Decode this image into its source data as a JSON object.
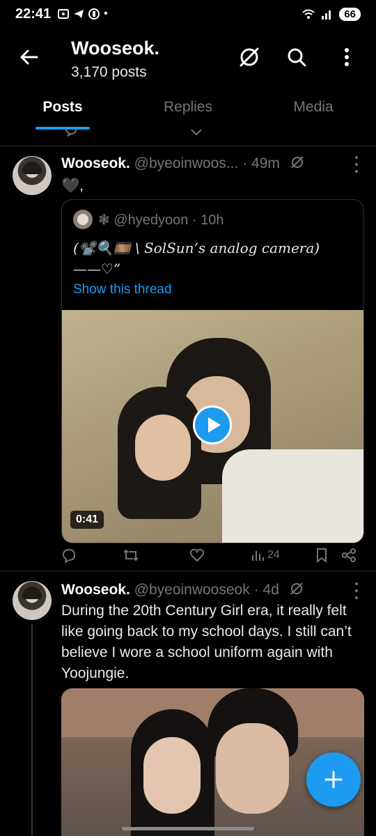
{
  "status_bar": {
    "time": "22:41",
    "battery": "66"
  },
  "header": {
    "title": "Wooseok.",
    "subtitle": "3,170 posts"
  },
  "tabs": [
    {
      "label": "Posts",
      "active": true
    },
    {
      "label": "Replies",
      "active": false
    },
    {
      "label": "Media",
      "active": false
    }
  ],
  "tweets": [
    {
      "name": "Wooseok.",
      "handle": "@byeoinwoos...",
      "time": "· 49m",
      "text": "🖤,",
      "quote": {
        "author": "❃ @hyedyoon · 10h",
        "text": "(📽️🔍🎞️ \\ SolSun’s analog camera) ——♡”",
        "link": "Show this thread",
        "media_duration": "0:41"
      },
      "stats": {
        "views": "24"
      }
    },
    {
      "name": "Wooseok.",
      "handle": "@byeoinwooseok",
      "time": "· 4d",
      "text": "During the 20th Century Girl era, it really felt like going back to my school days. I still can’t believe I wore a school uniform again with Yoojungie."
    }
  ],
  "colors": {
    "accent": "#1d9bf0",
    "muted": "#71767b",
    "background": "#000000"
  }
}
